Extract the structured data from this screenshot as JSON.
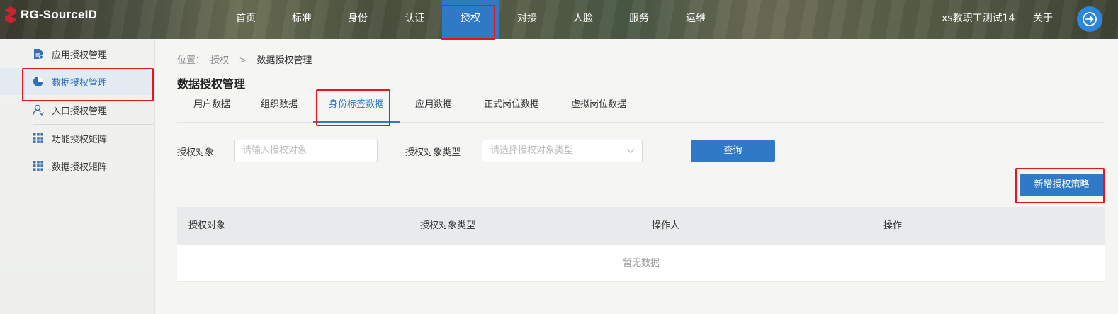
{
  "brand": {
    "name": "RG-SourceID",
    "accent": "#2f79c7",
    "logo_color": "#d0202f"
  },
  "topnav": {
    "items": [
      {
        "label": "首页"
      },
      {
        "label": "标准"
      },
      {
        "label": "身份"
      },
      {
        "label": "认证"
      },
      {
        "label": "授权",
        "active": true
      },
      {
        "label": "对接"
      },
      {
        "label": "人脸"
      },
      {
        "label": "服务"
      },
      {
        "label": "运维"
      }
    ],
    "user": "xs教职工测试14",
    "about": "关于",
    "logout_icon": "logout-icon"
  },
  "sidebar": {
    "items": [
      {
        "label": "应用授权管理",
        "icon": "document-icon"
      },
      {
        "label": "数据授权管理",
        "icon": "pie-chart-icon",
        "active": true
      },
      {
        "label": "入口授权管理",
        "icon": "user-icon"
      },
      {
        "label": "功能授权矩阵",
        "icon": "grid-icon"
      },
      {
        "label": "数据授权矩阵",
        "icon": "grid-icon"
      }
    ]
  },
  "breadcrumb": {
    "prefix": "位置：",
    "parent": "授权",
    "separator": ">",
    "current": "数据授权管理"
  },
  "page": {
    "title": "数据授权管理"
  },
  "tabs": [
    {
      "label": "用户数据"
    },
    {
      "label": "组织数据"
    },
    {
      "label": "身份标签数据",
      "active": true
    },
    {
      "label": "应用数据"
    },
    {
      "label": "正式岗位数据"
    },
    {
      "label": "虚拟岗位数据"
    }
  ],
  "filters": {
    "object_label": "授权对象",
    "object_placeholder": "请输入授权对象",
    "type_label": "授权对象类型",
    "type_placeholder": "请选择授权对象类型",
    "query_button": "查询"
  },
  "actions": {
    "add_button": "新增授权策略"
  },
  "table": {
    "columns": [
      "授权对象",
      "授权对象类型",
      "操作人",
      "操作"
    ],
    "rows": [],
    "empty_text": "暂无数据"
  }
}
